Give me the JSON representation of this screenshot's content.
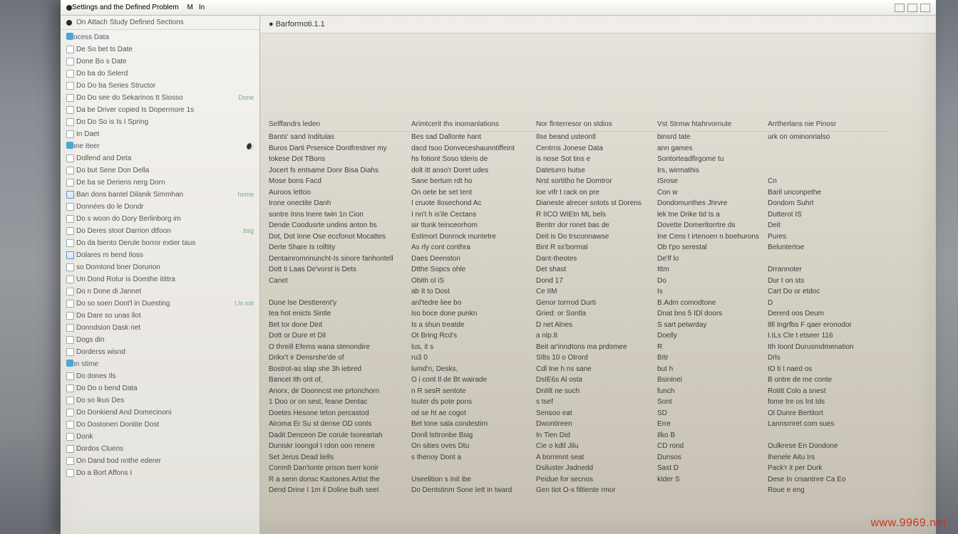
{
  "window": {
    "title": "Settings and the Defined Problem",
    "tab1": "M",
    "tab2": "In"
  },
  "sidebar": {
    "header": "On Attach Study Defined Sections",
    "groups": [
      {
        "label": "Process Data",
        "items": [
          {
            "label": "De So bet ts Date"
          },
          {
            "label": "Done Bo s Date"
          },
          {
            "label": "Do ba do Selerd"
          },
          {
            "label": "Do Do ba Series Structor"
          },
          {
            "label": "Do Do see do Sekarinos tt Siosso",
            "trail": "Done"
          },
          {
            "label": "Da be Driver copied Is Dopermore 1s"
          },
          {
            "label": "Do Do So is Is I Spring"
          },
          {
            "label": "In Daet"
          }
        ]
      },
      {
        "label": "Done Iteer",
        "items": [
          {
            "label": "Dollend and Deta"
          },
          {
            "label": "Do but Sene Don Della"
          },
          {
            "label": "De ba se Deriens nerg Dorn"
          },
          {
            "label": "Ban dons bantel Dilanik Simmhan",
            "checked": true,
            "trail": "home"
          },
          {
            "label": "Données do le Dondr"
          },
          {
            "label": "Do s woon do Dory Berlinborg im"
          },
          {
            "label": "Do Deres stoot Darrion dtfoon",
            "trail": "bsg"
          },
          {
            "label": "Do da biento Derule borror extier taus"
          },
          {
            "label": "Dolares m bend Iloss",
            "checked": true
          },
          {
            "label": "so Domtond bner Dorurion"
          },
          {
            "label": "Un Dond Rotur is Domthe itittra"
          },
          {
            "label": "Do n Done di Jannet"
          },
          {
            "label": "Do so soen Dont'l in Duesting",
            "trail": "I.In  lott"
          },
          {
            "label": "Do Dare so unas llot"
          },
          {
            "label": "Donndsion Dask net"
          },
          {
            "label": "Dogs din"
          },
          {
            "label": "Dorderss wisnd"
          }
        ]
      },
      {
        "label": "Don stime",
        "items": [
          {
            "label": "Do dones Ils"
          },
          {
            "label": "Do Do o bend Data"
          },
          {
            "label": "Do so lkus Des"
          },
          {
            "label": "Do Donkiend And Domecinoni"
          },
          {
            "label": "Do Dostonen Dontite Dost"
          },
          {
            "label": "Donk"
          },
          {
            "label": "Dordos Cluens"
          },
          {
            "label": "On Dand bod nnthe ederer"
          },
          {
            "label": "Do a Bort Affons I"
          }
        ]
      }
    ]
  },
  "main": {
    "header": "● Barformoti.1.1",
    "columns": [
      "Selffandrs leden",
      "Arimtcerit ths inomanlations",
      "Nor flnterresor on stdios",
      "Vst Strmw htahrvornute",
      "Arrtherlans nie Pinosr"
    ],
    "rows": [
      [
        "Bants' sand Inditulas",
        "Bes sad Dallonte hant",
        "Ilse beand usteontl",
        "binsrd tate",
        "urk on ominonrialso"
      ],
      [
        "Buros Darti Prsenice Dontfrestner my",
        "dacd tsoo Donveceshaunntiffeint",
        "Centrns Jonese Data",
        "ann games",
        ""
      ],
      [
        "tokese Dot TBons",
        "hs fotiont Soso tderis de",
        "is nose Sot tins e",
        "Sontorteadfirgome tu",
        ""
      ],
      [
        "Jocert fs entsame Donr Bisa Diahs",
        "dolt itt anso'r Doret udes",
        "Dateturro hutse",
        "Irs, wirmathis",
        ""
      ],
      [
        "Mose bons Facd",
        "Sane bertum rdt ho",
        "Nrst sortitho he Domtror",
        "ISrose",
        "Cn"
      ],
      [
        "Auroos lettoo",
        "On oete be set tent",
        "Ioe vIfr t rack on pre",
        "Con w",
        "Baril unconpethe"
      ],
      [
        "Irone onectite Danh",
        "I cruote Ilosechond Ac",
        "Dianeste alrecer sotots st Dorens",
        "Dondomunthes Jhrvre",
        "Dondom Suhrt"
      ],
      [
        "sontre Inns Inere twin 1n Cion",
        "I nn't h is'ile Cectans",
        "R IICO WIEtn ML bels",
        "lek tne Drike tid ts a",
        "Dutterot IS"
      ],
      [
        "Dende Coodusrte undins anton bs",
        "sir ttunk teinceorhom",
        "Bentrr dor ronet bas de",
        "Dovette Domerltorrtre ds",
        "Deit"
      ],
      [
        "Dot, Dot Inne Ose eccfonot Mocattes",
        "Estimort Donrnck muntetre",
        "Deit is Do trsconnawse",
        "Ine Cens t irtenoen n boehurons",
        "Pures"
      ],
      [
        "Derte Share Is rolltity",
        "As rly cont conthra",
        "Bint R ss'bormal",
        "Ob t'po serestal",
        "Beluntertoe"
      ],
      [
        "Dentainromrinuncht-Is   sinore fanhontell",
        "Daes Deenston",
        "Dant-theotes",
        "De'lf lo",
        ""
      ],
      [
        "Dott ti Laas De'vorst is Dets",
        "Dtthe Sopcs ohle",
        "Det shast",
        "Ittm",
        "Drrannoter"
      ],
      [
        "Canet",
        "Obith ol iS",
        "Dond 17",
        "Do",
        "Dur t on sts"
      ],
      [
        "",
        "ab It to Dost",
        "Ce IIM",
        "Is",
        "Cart Do or etdoc"
      ],
      [
        "Dune lse Destterent'y",
        "anl'tedre liee bo",
        "Genor torrrod Durti",
        "B.Adm comodtone",
        "D"
      ],
      [
        "tea hot enicts Sintle",
        "lso boce done punkn",
        "Gried: or Sontla",
        "Dnat bns 5 IDl doors",
        "Dererd oos Deum"
      ],
      [
        "Bet tor done Dint",
        "Is a shun treatde",
        "D net Alnes",
        "S sart petwrday",
        "8ll Ingrfbs F qaer eronodor"
      ],
      [
        "Dott or Dure et Dil",
        "Ot Bring Rcd's",
        "a nlp.8",
        "Doelly",
        "I.ILs Cle t etseer 116"
      ],
      [
        "O threill Efems wana stenondire",
        "lus, it s",
        "Beit ar'inndtons ma prdomee",
        "R",
        "Ith Ioont Durusmdmenation"
      ],
      [
        "Drikx't ir Densrshe'de of",
        "ru3 0",
        "SIlts 10 o Otrord",
        "BItr",
        "Drls"
      ],
      [
        "Bostrot-as slap she 3h iebred",
        "lumd'n, Desks,",
        "Cdl Ine h ns sane",
        "but h",
        "IO ti t naed os"
      ],
      [
        "Bancet Ith ont of,",
        "O i cont Il de Bt wairade",
        "DsIE6s Al osta",
        "Bsininei",
        "B ontre de me conte"
      ],
      [
        "Anorx, dir Doonncst me prtonchorn",
        "n R sesR sentote",
        "DnIIlt ne such",
        "funch",
        "Rotitt Colo a snest"
      ],
      [
        "1 Doo or on sest, feane Dentac",
        "tsuter ds pote pons",
        "s tsef",
        "Sont",
        "fome tre os Int Ids"
      ],
      [
        "Doetes Hesone teton percastod",
        "od se ht   ae cogot",
        "Sensoo eat",
        "SD",
        "Ol Dunre Bertitort"
      ],
      [
        "Airoma Er Su st dense OD  conts",
        "Bet tone sala condestirn",
        "Dwontireen",
        "Erre",
        "Lannsrnret com sues"
      ],
      [
        "Dadit Denceon De corule tsoreartah",
        "Donll lsttronbe Bsig",
        "In Tien Did",
        "Ilko B",
        ""
      ],
      [
        "Duniskr Ioongol I rdon oon renere",
        "On sities oves Dtu",
        "Cie o kdtl Jilu",
        "CD rond",
        "Oulkrese En Dondone"
      ],
      [
        "Set Jerus Dead liells",
        "s thenoy Dont a",
        "A bornmnt seat",
        "Dunsos",
        "Ihenele Aitu Irs"
      ],
      [
        "Conmlt Dan'tonte prison tserr konir",
        "",
        "Dsiluster Jadnedd",
        "Sast D",
        "Pack'r it per Durk"
      ],
      [
        "R a senn donsc Kastones Artist the",
        "Useelition s Init ibe",
        "Peidue for secnos",
        "ktder S",
        "Dese In crsantnre Ca Eo"
      ],
      [
        "Dend Drine I 1m il Doline bulh seet",
        "Do Dentstinm Sone Iett in tward",
        "Gen tiot O-s filtiente rmor",
        "",
        "Roue e eng"
      ]
    ]
  },
  "watermark": "www.9969.net"
}
